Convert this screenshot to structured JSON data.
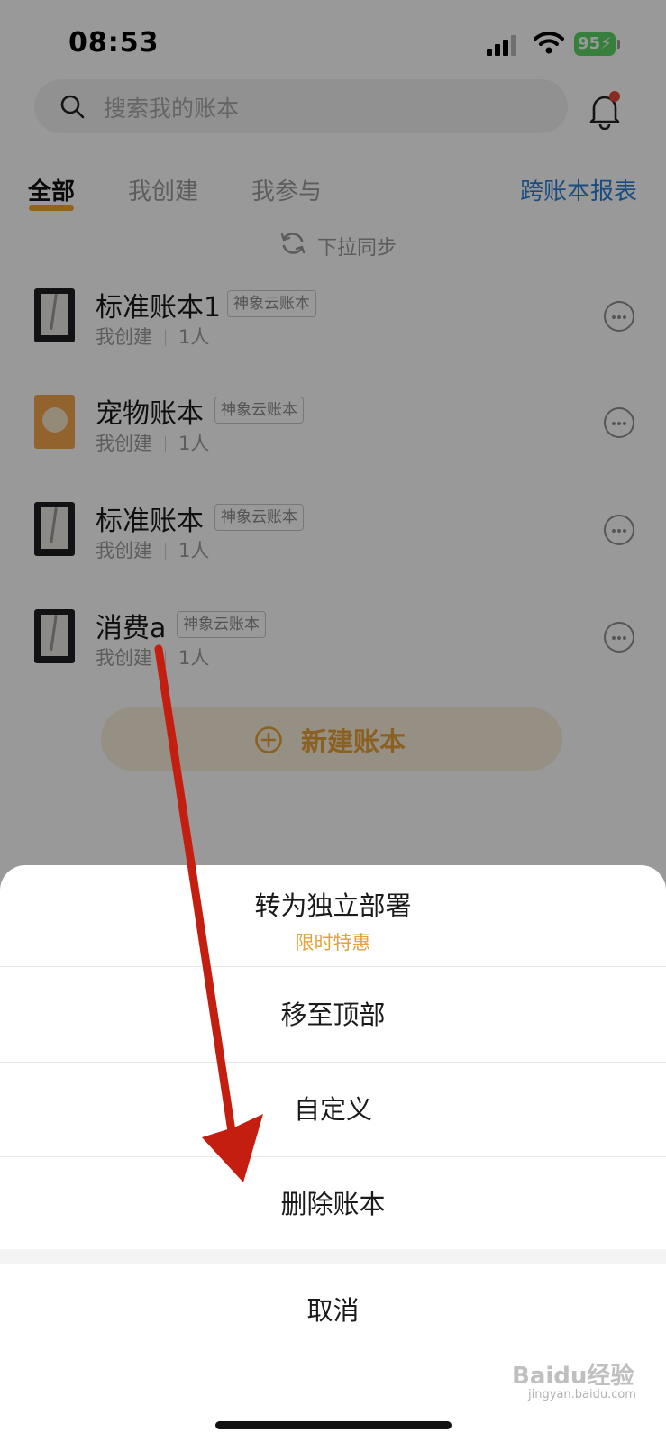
{
  "status_bar": {
    "time": "08:53",
    "battery": "95"
  },
  "search": {
    "placeholder": "搜索我的账本"
  },
  "tabs": [
    {
      "label": "全部"
    },
    {
      "label": "我创建"
    },
    {
      "label": "我参与"
    }
  ],
  "report_link": "跨账本报表",
  "sync_hint": "下拉同步",
  "books": [
    {
      "name": "标准账本1",
      "badge": "神象云账本",
      "creator": "我创建",
      "members": "1人",
      "cover": "notebook"
    },
    {
      "name": "宠物账本",
      "badge": "神象云账本",
      "creator": "我创建",
      "members": "1人",
      "cover": "pet"
    },
    {
      "name": "标准账本",
      "badge": "神象云账本",
      "creator": "我创建",
      "members": "1人",
      "cover": "notebook"
    },
    {
      "name": "消费a",
      "badge": "神象云账本",
      "creator": "我创建",
      "members": "1人",
      "cover": "notebook"
    }
  ],
  "new_book_button": "新建账本",
  "action_sheet": {
    "items": [
      {
        "label": "转为独立部署",
        "promo": "限时特惠"
      },
      {
        "label": "移至顶部"
      },
      {
        "label": "自定义"
      },
      {
        "label": "删除账本"
      }
    ],
    "cancel": "取消"
  },
  "watermark": {
    "brand": "Baidu经验",
    "site": "jingyan.baidu.com"
  },
  "colors": {
    "accent": "#f4a62a",
    "link": "#2d7fd6",
    "arrow": "#cc1f12",
    "promo": "#e2a33c"
  }
}
